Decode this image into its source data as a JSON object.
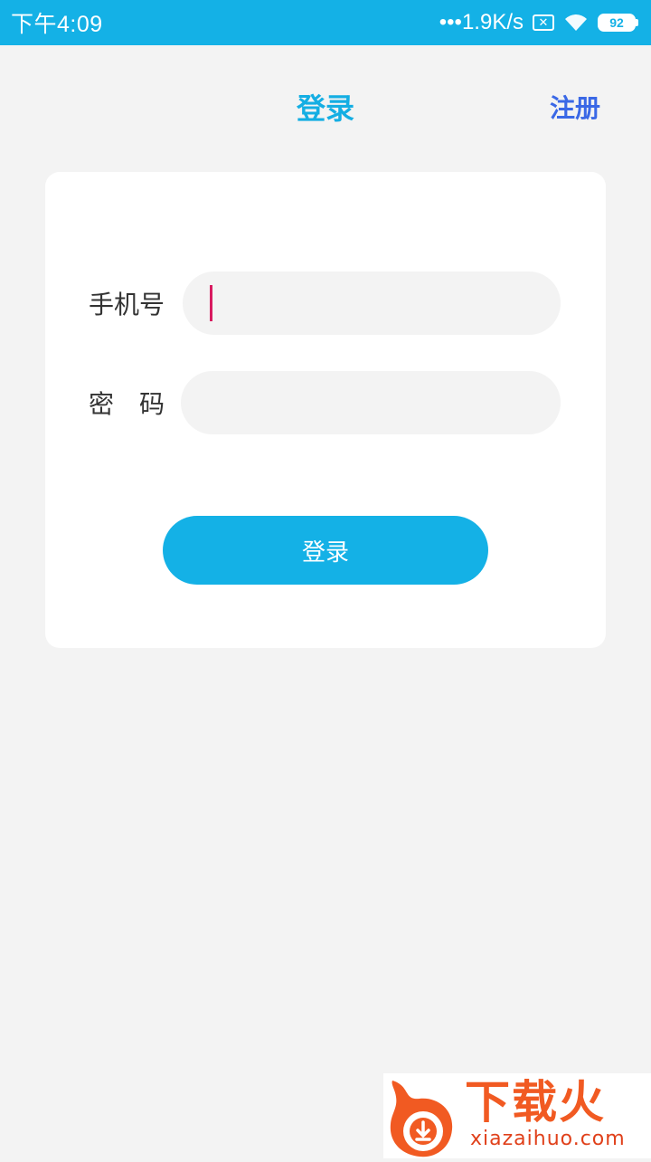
{
  "status_bar": {
    "time": "下午4:09",
    "net_speed": "•••1.9K/s",
    "sim_icon": "sim-off-icon",
    "wifi_icon": "wifi-icon",
    "battery": "92"
  },
  "header": {
    "title": "登录",
    "register_label": "注册"
  },
  "form": {
    "phone_label": "手机号",
    "phone_value": "",
    "password_label": "密　码",
    "password_value": ""
  },
  "actions": {
    "login_label": "登录"
  },
  "watermark": {
    "brand_cn": "下载火",
    "brand_url": "xiazaihuo.com"
  },
  "colors": {
    "accent": "#14b1e6",
    "register_link": "#3a68e6",
    "background": "#f3f3f3",
    "caret": "#d81b60",
    "watermark": "#f15a22"
  }
}
